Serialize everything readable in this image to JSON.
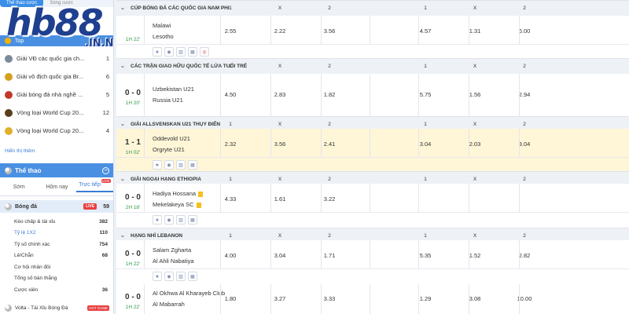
{
  "sidebar": {
    "top_tabs": [
      "Thể thao cược",
      "Sòng cược"
    ],
    "logo_main": "hb88",
    "logo_suffix": ".IN.NET",
    "top_label": "Top",
    "leagues": [
      {
        "name": "Giải VĐ các quốc gia ch...",
        "count": "1",
        "color": "#7b8a9a"
      },
      {
        "name": "Giải vô địch quốc gia Br...",
        "count": "6",
        "color": "#d4a11e"
      },
      {
        "name": "Giải bóng đá nhà nghề ...",
        "count": "5",
        "color": "#c0392b"
      },
      {
        "name": "Vòng loại World Cup 20...",
        "count": "12",
        "color": "#5a3e1b"
      },
      {
        "name": "Vòng loại World Cup 20...",
        "count": "4",
        "color": "#e0b02a"
      }
    ],
    "show_more": "Hiển thị thêm",
    "sports_title": "Thể thao",
    "sports_tabs": [
      "Sớm",
      "Hôm nay",
      "Trực tiếp"
    ],
    "live_badge": "LIVE",
    "sport": {
      "name": "Bóng đá",
      "live": "LIVE",
      "count": "59"
    },
    "markets": [
      {
        "label": "Kèo chấp & tài xỉu",
        "count": "382"
      },
      {
        "label": "Tỷ lệ 1X2",
        "count": "110"
      },
      {
        "label": "Tỷ số chính xác",
        "count": "754"
      },
      {
        "label": "Lẻ/Chẵn",
        "count": "68"
      },
      {
        "label": "Cơ hội nhân đôi",
        "count": ""
      },
      {
        "label": "Tổng số bàn thắng",
        "count": ""
      },
      {
        "label": "Cược xiên",
        "count": "36"
      }
    ],
    "volta": {
      "label": "Volta - Tài Xỉu Bóng Đá",
      "badge": "HOT GAME"
    }
  },
  "main": {
    "col_headers": [
      "1",
      "X",
      "2",
      "1",
      "X",
      "2"
    ],
    "sections": [
      {
        "title": "CÚP BÓNG ĐÁ CÁC QUỐC GIA NAM PHI",
        "matches": [
          {
            "score": "",
            "time": "1H 22'",
            "home": "Malawi",
            "away": "Lesotho",
            "odds": [
              "2.55",
              "2.22",
              "3.56",
              "4.57",
              "1.31",
              "6.00"
            ],
            "icons": [
              "star",
              "eye",
              "chart",
              "grid",
              "live"
            ]
          }
        ]
      },
      {
        "title": "CÁC TRẬN GIAO HỮU QUỐC TẾ LỨA TUỔI TRẺ",
        "matches": [
          {
            "score": "0 - 0",
            "time": "1H 20'",
            "home": "Uzbekistan U21",
            "away": "Russia U21",
            "odds": [
              "4.50",
              "2.83",
              "1.82",
              "5.75",
              "1.56",
              "2.94"
            ],
            "icons": []
          }
        ]
      },
      {
        "title": "GIẢI ALLSVENSKAN U21 THỤY ĐIỂN",
        "matches": [
          {
            "score": "1 - 1",
            "time": "1H 02'",
            "home": "Oddevold U21",
            "away": "Orgryte U21",
            "odds": [
              "2.32",
              "3.56",
              "2.41",
              "3.04",
              "2.03",
              "3.04"
            ],
            "icons": [
              "star",
              "eye",
              "chart",
              "grid"
            ]
          }
        ]
      },
      {
        "title": "GIẢI NGOẠI HẠNG ETHIOPIA",
        "matches": [
          {
            "score": "0 - 0",
            "time": "2H 18'",
            "home": "Hadiya Hossana",
            "away": "Mekelakeya SC",
            "odds": [
              "4.33",
              "1.61",
              "3.22",
              "",
              "",
              ""
            ],
            "icons": [
              "star",
              "eye",
              "chart",
              "grid"
            ]
          }
        ]
      },
      {
        "title": "HẠNG NHÌ LEBANON",
        "matches": [
          {
            "score": "0 - 0",
            "time": "1H 22'",
            "home": "Salam Zgharta",
            "away": "Al Ahli Nabatiya",
            "odds": [
              "4.00",
              "3.04",
              "1.71",
              "5.35",
              "1.52",
              "2.82"
            ],
            "icons": [
              "star",
              "eye",
              "chart",
              "grid"
            ]
          },
          {
            "score": "0 - 0",
            "time": "1H 22'",
            "home": "Al Okhwa Al Kharayeb Club",
            "away": "Al Mabarrah",
            "odds": [
              "1.80",
              "3.27",
              "3.33",
              "1.29",
              "3.08",
              "10.00"
            ],
            "icons": []
          }
        ]
      }
    ]
  }
}
